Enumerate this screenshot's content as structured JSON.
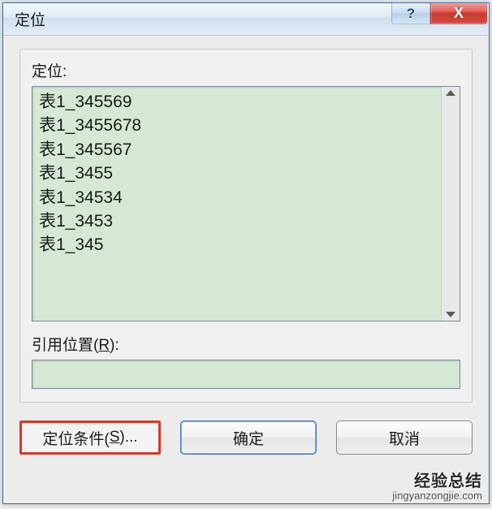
{
  "window": {
    "title": "定位",
    "help_symbol": "?",
    "close_symbol": "X"
  },
  "group": {
    "goto_label": "定位:",
    "reference_label_prefix": "引用位置(",
    "reference_label_key": "R",
    "reference_label_suffix": "):",
    "reference_value": ""
  },
  "list_items": [
    "表1_345569",
    "表1_3455678",
    "表1_345567",
    "表1_3455",
    "表1_34534",
    "表1_3453",
    "表1_345"
  ],
  "buttons": {
    "special_prefix": "定位条件(",
    "special_key": "S",
    "special_suffix": ")...",
    "ok": "确定",
    "cancel": "取消"
  },
  "watermark": {
    "cn": "经验总结",
    "en": "jingyanzongjie.com"
  }
}
